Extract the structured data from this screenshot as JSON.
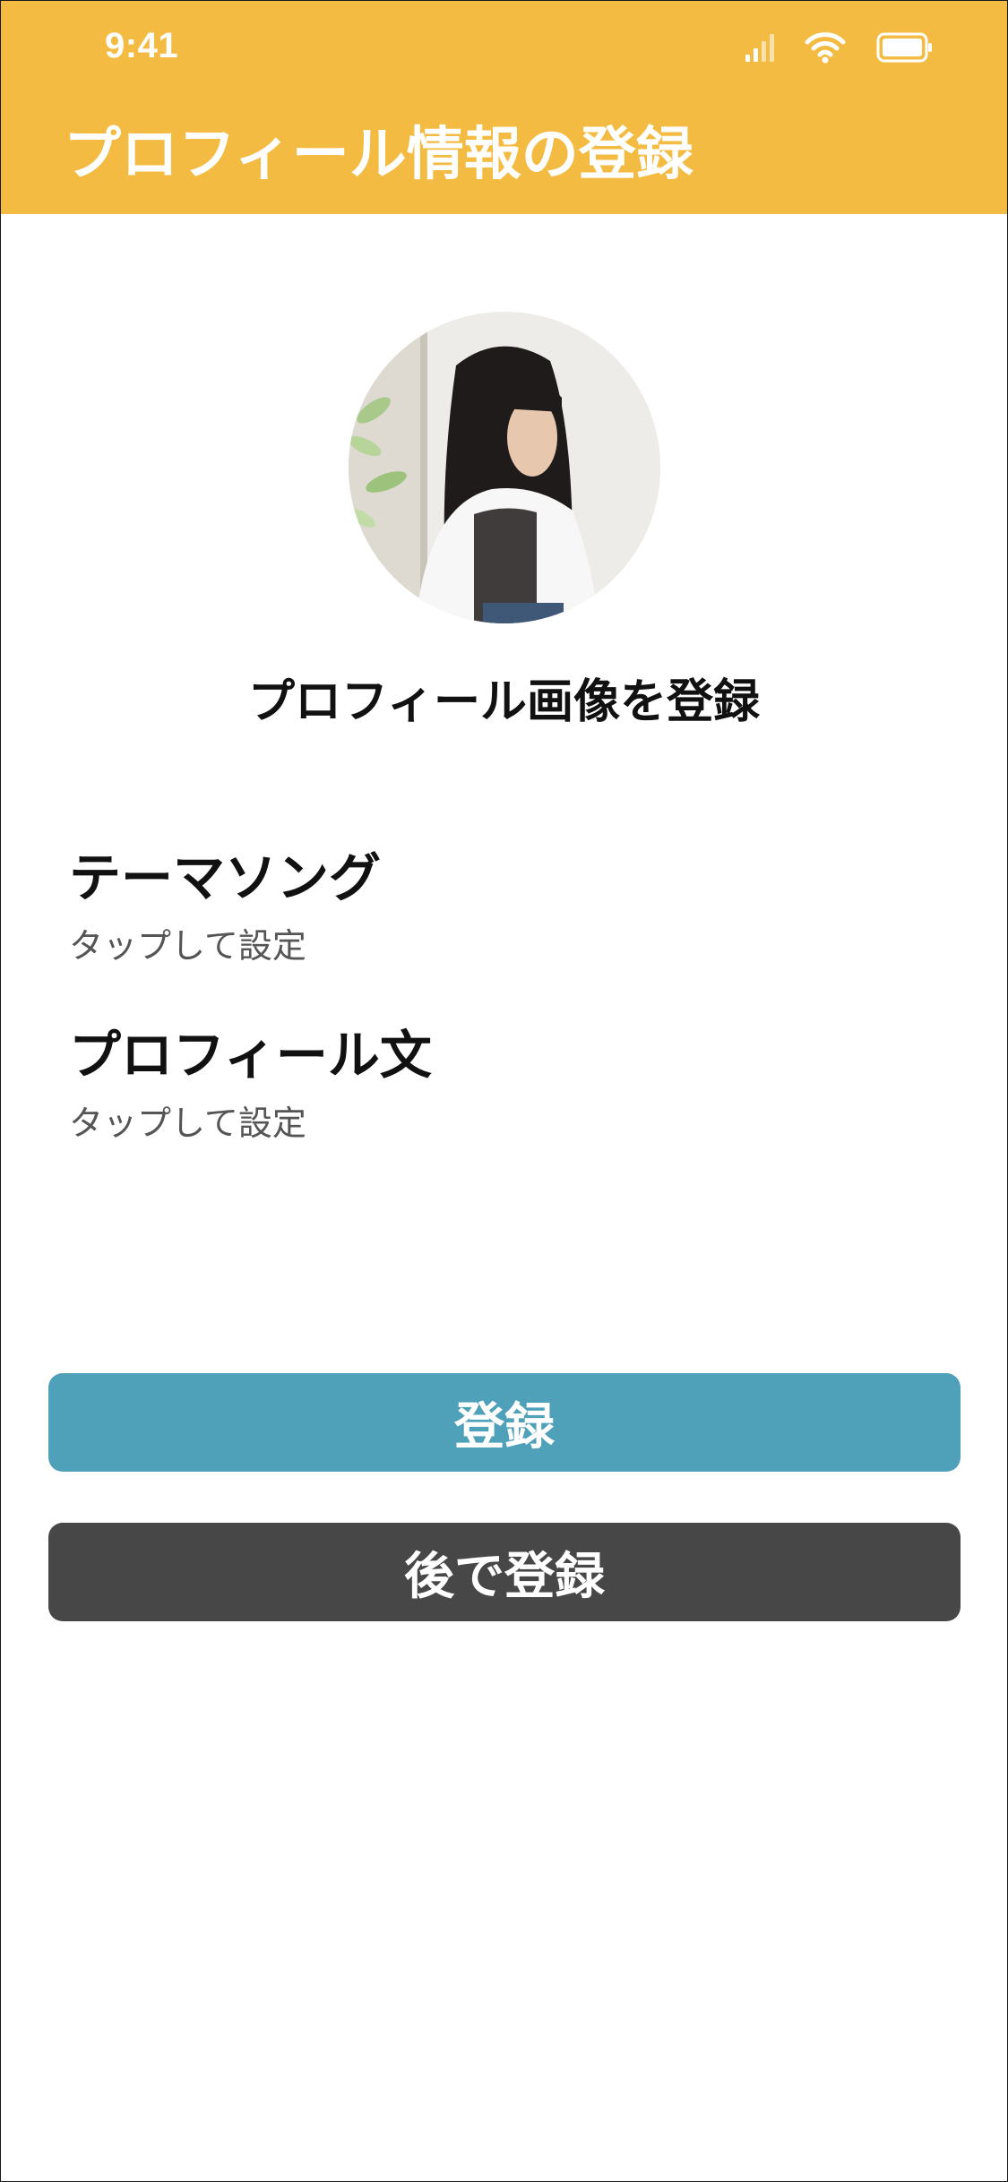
{
  "status_bar": {
    "time": "9:41",
    "icons": [
      "cellular-signal-icon",
      "wifi-icon",
      "battery-icon"
    ]
  },
  "header": {
    "title": "プロフィール情報の登録",
    "background_color": "#F4BB42"
  },
  "profile_image": {
    "caption": "プロフィール画像を登録"
  },
  "settings": [
    {
      "label": "テーマソング",
      "hint": "タップして設定"
    },
    {
      "label": "プロフィール文",
      "hint": "タップして設定"
    }
  ],
  "buttons": {
    "register": {
      "label": "登録",
      "color": "#4FA1B9"
    },
    "later": {
      "label": "後で登録",
      "color": "#474747"
    }
  }
}
